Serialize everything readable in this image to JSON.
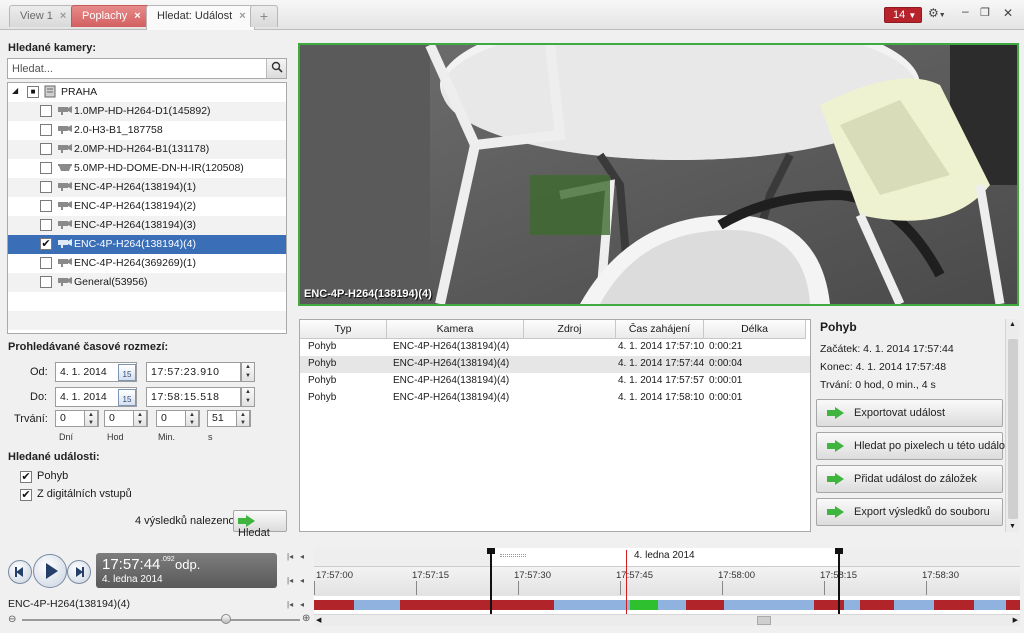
{
  "tabs": [
    {
      "label": "View 1",
      "close": "×"
    },
    {
      "label": "Poplachy",
      "close": "×"
    },
    {
      "label": "Hledat: Událost",
      "close": "×"
    },
    {
      "label": "+"
    }
  ],
  "alarm_count": "14",
  "camera_search": {
    "title": "Hledané kamery:",
    "placeholder": "Hledat..."
  },
  "tree": {
    "root": "PRAHA",
    "items": [
      {
        "label": "1.0MP-HD-H264-D1(145892)",
        "checked": false
      },
      {
        "label": "2.0-H3-B1_187758",
        "checked": false
      },
      {
        "label": "2.0MP-HD-H264-B1(131178)",
        "checked": false
      },
      {
        "label": "5.0MP-HD-DOME-DN-H-IR(120508)",
        "checked": false
      },
      {
        "label": "ENC-4P-H264(138194)(1)",
        "checked": false
      },
      {
        "label": "ENC-4P-H264(138194)(2)",
        "checked": false
      },
      {
        "label": "ENC-4P-H264(138194)(3)",
        "checked": false
      },
      {
        "label": "ENC-4P-H264(138194)(4)",
        "checked": true
      },
      {
        "label": "ENC-4P-H264(369269)(1)",
        "checked": false
      },
      {
        "label": "General(53956)",
        "checked": false
      }
    ]
  },
  "time_range": {
    "title": "Prohledávané časové rozmezí:",
    "from_label": "Od:",
    "from_date": "4. 1. 2014",
    "from_time": "17:57:23.910",
    "to_label": "Do:",
    "to_date": "4. 1. 2014",
    "to_time": "17:58:15.518",
    "cal_icon": "15",
    "duration_label": "Trvání:",
    "days": "0",
    "hours": "0",
    "minutes": "0",
    "seconds": "51",
    "days_unit": "Dní",
    "hours_unit": "Hod",
    "minutes_unit": "Min.",
    "seconds_unit": "s"
  },
  "events": {
    "title": "Hledané události:",
    "motion": "Pohyb",
    "digital": "Z digitálních vstupů",
    "result_count": "4 výsledků nalezeno",
    "search_button": "Hledat"
  },
  "video": {
    "camera_label": "ENC-4P-H264(138194)(4)"
  },
  "results": {
    "headers": [
      "Typ",
      "Kamera",
      "Zdroj",
      "Čas zahájení",
      "Délka"
    ],
    "rows": [
      {
        "typ": "Pohyb",
        "kamera": "ENC-4P-H264(138194)(4)",
        "zdroj": "",
        "cas": "4. 1. 2014 17:57:10",
        "delka": "0:00:21"
      },
      {
        "typ": "Pohyb",
        "kamera": "ENC-4P-H264(138194)(4)",
        "zdroj": "",
        "cas": "4. 1. 2014 17:57:44",
        "delka": "0:00:04"
      },
      {
        "typ": "Pohyb",
        "kamera": "ENC-4P-H264(138194)(4)",
        "zdroj": "",
        "cas": "4. 1. 2014 17:57:57",
        "delka": "0:00:01"
      },
      {
        "typ": "Pohyb",
        "kamera": "ENC-4P-H264(138194)(4)",
        "zdroj": "",
        "cas": "4. 1. 2014 17:58:10",
        "delka": "0:00:01"
      }
    ]
  },
  "detail": {
    "title": "Pohyb",
    "start": "Začátek: 4. 1. 2014 17:57:44",
    "end": "Konec: 4. 1. 2014 17:57:48",
    "duration": "Trvání:  0 hod, 0 min., 4 s",
    "actions": [
      "Exportovat událost",
      "Hledat po pixelech u této události",
      "Přidat událost do záložek",
      "Export výsledků do souboru"
    ]
  },
  "playback": {
    "time": "17:57:44",
    "ms": ".092",
    "suffix": "odp.",
    "date": "4. ledna 2014",
    "camera": "ENC-4P-H264(138194)(4)"
  },
  "timeline": {
    "date": "4. ledna 2014",
    "ticks": [
      "17:57:00",
      "17:57:15",
      "17:57:30",
      "17:57:45",
      "17:58:00",
      "17:58:15",
      "17:58:30"
    ]
  },
  "colors": {
    "accent_blue": "#3a6fb7",
    "alarm_red": "#b8222b",
    "video_border": "#3faa3f",
    "tl_red": "#b0242a",
    "tl_blue": "#8fb3de",
    "tl_green": "#2fc02f"
  }
}
